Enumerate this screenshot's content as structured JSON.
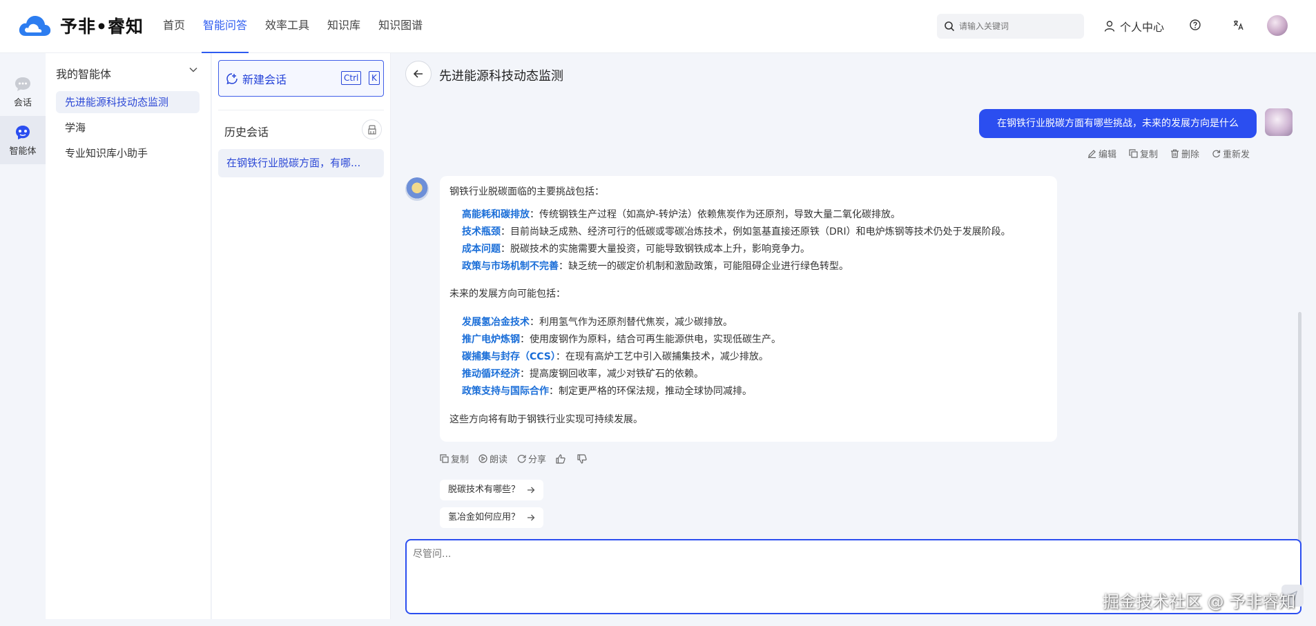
{
  "brand": {
    "name": "予非•睿知",
    "accent": "#2d5bf0"
  },
  "nav": [
    {
      "label": "首页"
    },
    {
      "label": "智能问答"
    },
    {
      "label": "效率工具"
    },
    {
      "label": "知识库"
    },
    {
      "label": "知识图谱"
    }
  ],
  "search": {
    "placeholder": "请输入关键词"
  },
  "user_center": {
    "label": "个人中心"
  },
  "rail": {
    "chat_label": "会话",
    "agent_label": "智能体"
  },
  "agents": {
    "title": "我的智能体",
    "items": [
      {
        "label": "先进能源科技动态监测"
      },
      {
        "label": "学海"
      },
      {
        "label": "专业知识库小助手"
      }
    ]
  },
  "sessions": {
    "new_chat": "新建会话",
    "shortcut_ctrl": "Ctrl",
    "shortcut_key": "K",
    "history_title": "历史会话",
    "items": [
      {
        "label": "在钢铁行业脱碳方面，有哪..."
      }
    ]
  },
  "chat": {
    "title": "先进能源科技动态监测",
    "user_message": "在钢铁行业脱碳方面有哪些挑战，未来的发展方向是什么",
    "user_actions": {
      "edit": "编辑",
      "copy": "复制",
      "delete": "删除",
      "resend": "重新发"
    },
    "answer": {
      "intro": "钢铁行业脱碳面临的主要挑战包括：",
      "challenges": [
        {
          "term": "高能耗和碳排放",
          "text": "：传统钢铁生产过程（如高炉-转炉法）依赖焦炭作为还原剂，导致大量二氧化碳排放。"
        },
        {
          "term": "技术瓶颈",
          "text": "：目前尚缺乏成熟、经济可行的低碳或零碳冶炼技术，例如氢基直接还原铁（DRI）和电炉炼钢等技术仍处于发展阶段。"
        },
        {
          "term": "成本问题",
          "text": "：脱碳技术的实施需要大量投资，可能导致钢铁成本上升，影响竞争力。"
        },
        {
          "term": "政策与市场机制不完善",
          "text": "：缺乏统一的碳定价机制和激励政策，可能阻碍企业进行绿色转型。"
        }
      ],
      "future_intro": "未来的发展方向可能包括：",
      "directions": [
        {
          "term": "发展氢冶金技术",
          "text": "：利用氢气作为还原剂替代焦炭，减少碳排放。"
        },
        {
          "term": "推广电炉炼钢",
          "text": "：使用废钢作为原料，结合可再生能源供电，实现低碳生产。"
        },
        {
          "term": "碳捕集与封存（CCS）",
          "text": "：在现有高炉工艺中引入碳捕集技术，减少排放。"
        },
        {
          "term": "推动循环经济",
          "text": "：提高废钢回收率，减少对铁矿石的依赖。"
        },
        {
          "term": "政策支持与国际合作",
          "text": "：制定更严格的环保法规，推动全球协同减排。"
        }
      ],
      "conclusion": "这些方向将有助于钢铁行业实现可持续发展。"
    },
    "bot_actions": {
      "copy": "复制",
      "read": "朗读",
      "share": "分享"
    },
    "suggestions": [
      {
        "label": "脱碳技术有哪些？"
      },
      {
        "label": "氢冶金如何应用？"
      }
    ],
    "input_placeholder": "尽管问..."
  },
  "watermark": "掘金技术社区 @ 予非睿知"
}
